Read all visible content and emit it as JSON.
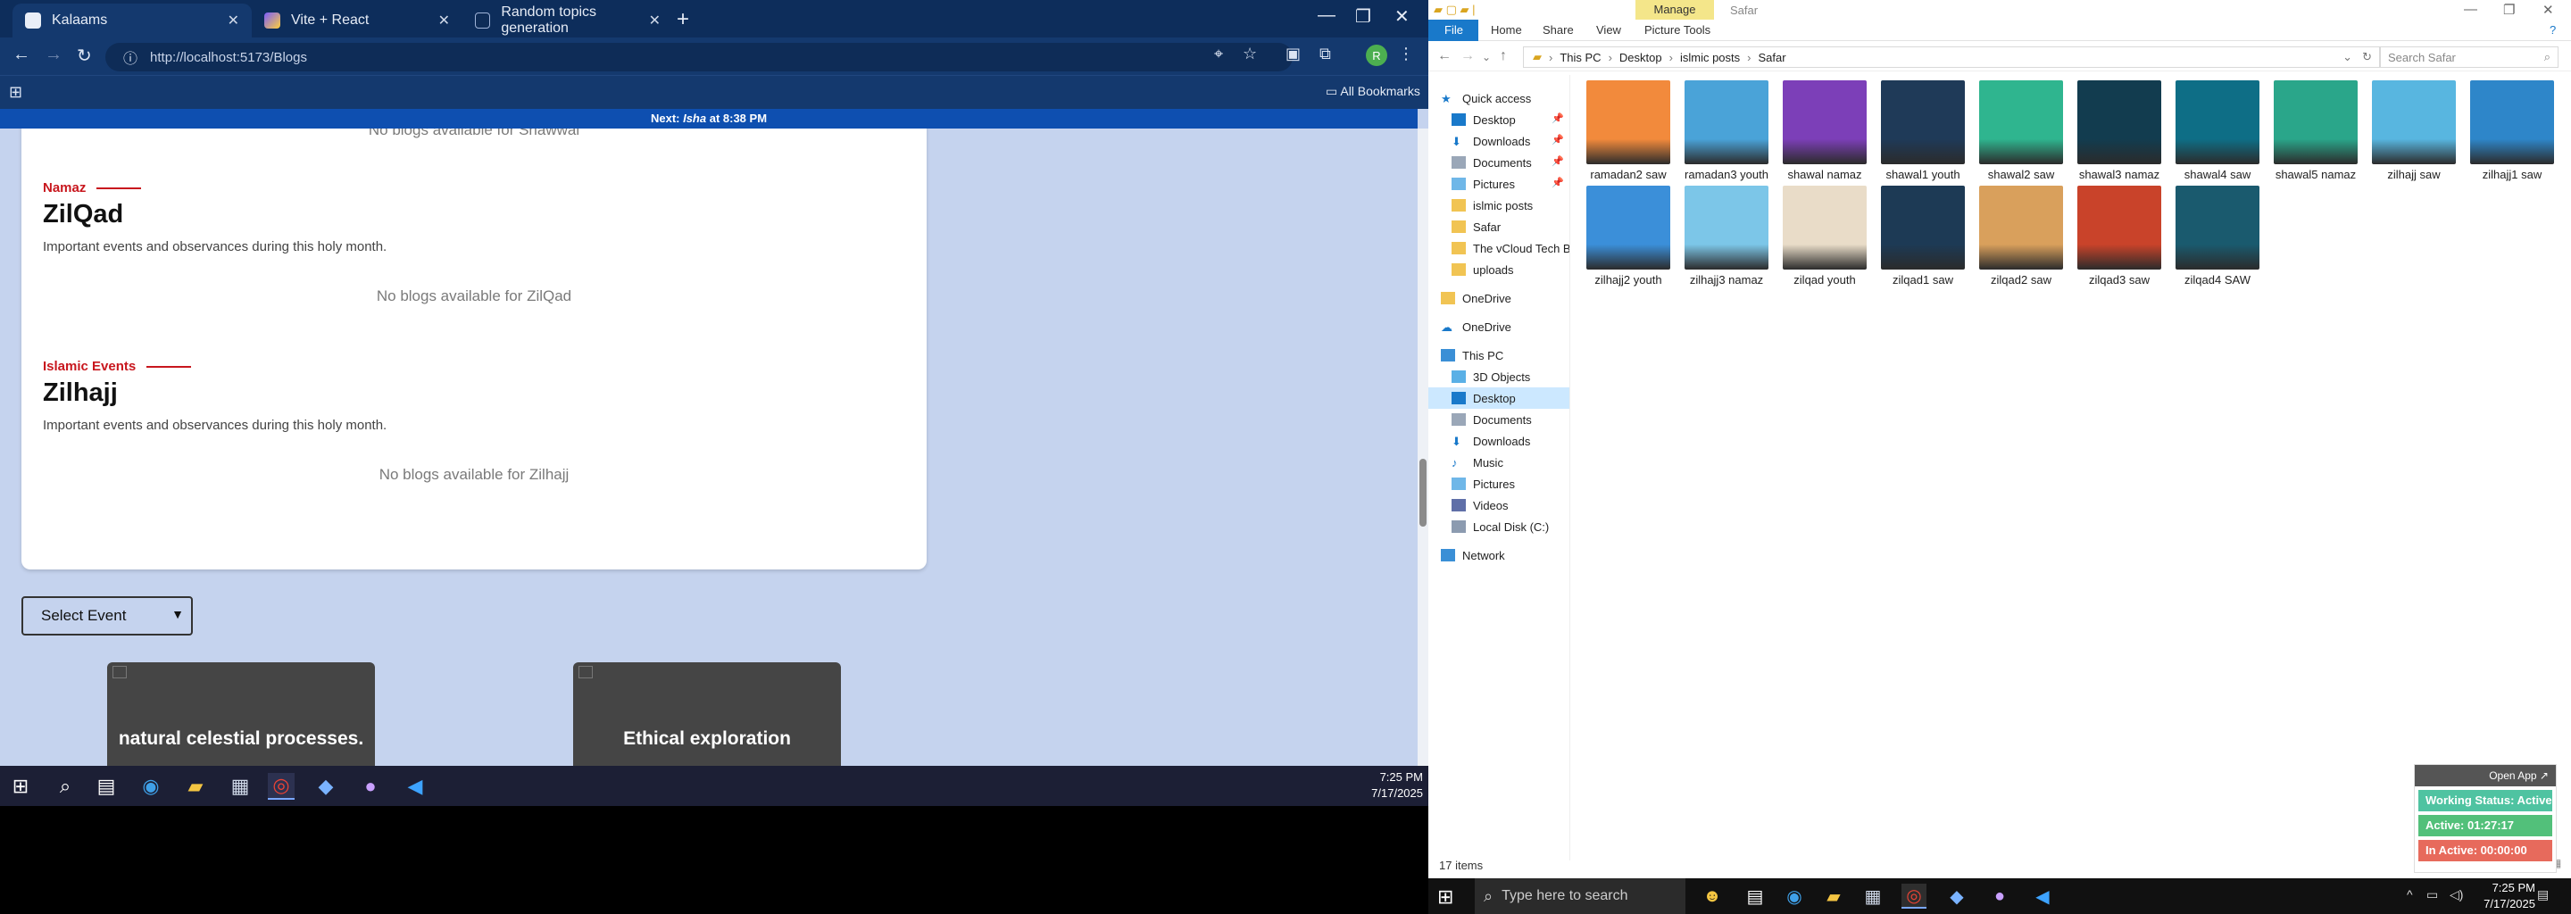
{
  "chrome": {
    "tabs": [
      {
        "label": "Kalaams",
        "active": true
      },
      {
        "label": "Vite + React",
        "active": false
      },
      {
        "label": "Random topics generation",
        "active": false
      }
    ],
    "url": "http://localhost:5173/Blogs",
    "bookmarks_label": "All Bookmarks",
    "profile_initial": "R",
    "notice_prefix": "Next: ",
    "notice_bold": "Isha",
    "notice_suffix": " at 8:38 PM"
  },
  "page": {
    "top_empty": "No blogs available for Shawwal",
    "sections": [
      {
        "label": "Namaz",
        "title": "ZilQad",
        "description": "Important events and observances during this holy month.",
        "empty": "No blogs available for ZilQad"
      },
      {
        "label": "Islamic Events",
        "title": "Zilhajj",
        "description": "Important events and observances during this holy month.",
        "empty": "No blogs available for Zilhajj"
      }
    ],
    "select_value": "Select Event",
    "cards": [
      "natural celestial processes.",
      "Ethical exploration"
    ]
  },
  "taskbar_left": {
    "time": "7:25 PM",
    "date": "7/17/2025"
  },
  "explorer": {
    "ribbon_tabs": [
      "File",
      "Home",
      "Share",
      "View",
      "Picture Tools"
    ],
    "contextual_tab": "Manage",
    "window_title": "Safar",
    "breadcrumb": [
      "This PC",
      "Desktop",
      "islmic posts",
      "Safar"
    ],
    "search_placeholder": "Search Safar",
    "nav": {
      "quick_access": "Quick access",
      "quick_items": [
        "Desktop",
        "Downloads",
        "Documents",
        "Pictures",
        "islmic posts",
        "Safar",
        "The vCloud Tech Bl",
        "uploads"
      ],
      "onedrive1": "OneDrive",
      "onedrive2": "OneDrive",
      "this_pc": "This PC",
      "pc_items": [
        "3D Objects",
        "Desktop",
        "Documents",
        "Downloads",
        "Music",
        "Pictures",
        "Videos",
        "Local Disk (C:)"
      ],
      "network": "Network"
    },
    "files": [
      {
        "name": "ramadan2 saw",
        "color": "#f28a3c"
      },
      {
        "name": "ramadan3 youth",
        "color": "#4aa3d8"
      },
      {
        "name": "shawal namaz",
        "color": "#7c3fb8"
      },
      {
        "name": "shawal1 youth",
        "color": "#1f3a58"
      },
      {
        "name": "shawal2 saw",
        "color": "#2fb58f"
      },
      {
        "name": "shawal3 namaz",
        "color": "#123c4f"
      },
      {
        "name": "shawal4 saw",
        "color": "#0e6e86"
      },
      {
        "name": "shawal5 namaz",
        "color": "#2aa68a"
      },
      {
        "name": "zilhajj saw",
        "color": "#58b6e0"
      },
      {
        "name": "zilhajj1 saw",
        "color": "#2e86c9"
      },
      {
        "name": "zilhajj2 youth",
        "color": "#3b8fd9"
      },
      {
        "name": "zilhajj3 namaz",
        "color": "#7cc6e8"
      },
      {
        "name": "zilqad youth",
        "color": "#e9dcc8"
      },
      {
        "name": "zilqad1 saw",
        "color": "#1d3a55"
      },
      {
        "name": "zilqad2 saw",
        "color": "#d9a05c"
      },
      {
        "name": "zilqad3 saw",
        "color": "#c9432a"
      },
      {
        "name": "zilqad4 SAW",
        "color": "#1a5a6e"
      }
    ],
    "status": "17 items"
  },
  "tracker": {
    "head": "Open App ↗",
    "working": "Working Status: Active",
    "active": "Active: 01:27:17",
    "inactive": "In Active: 00:00:00"
  },
  "taskbar_right": {
    "search_placeholder": "Type here to search",
    "time": "7:25 PM",
    "date": "7/17/2025"
  }
}
